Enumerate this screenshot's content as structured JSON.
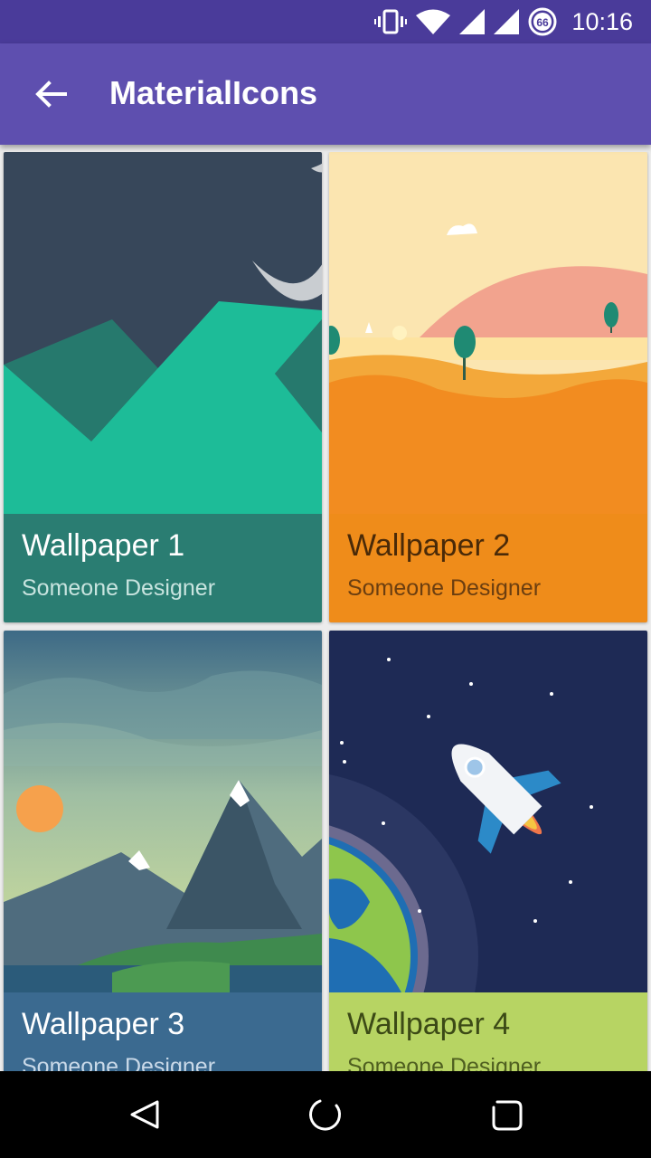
{
  "status_bar": {
    "time": "10:16",
    "battery_level": "66",
    "icons": [
      "vibrate-icon",
      "wifi-icon",
      "signal-icon",
      "signal-icon",
      "battery-icon"
    ]
  },
  "app_bar": {
    "title": "MaterialIcons",
    "back_icon": "back-arrow-icon"
  },
  "cards": [
    {
      "title": "Wallpaper 1",
      "subtitle": "Someone Designer",
      "caption_color": "#2a7d72",
      "text_color": "#ffffff",
      "sub_color": "#c8e4df"
    },
    {
      "title": "Wallpaper 2",
      "subtitle": "Someone Designer",
      "caption_color": "#ef8c1a",
      "text_color": "#4a2a08",
      "sub_color": "#6b3e10"
    },
    {
      "title": "Wallpaper 3",
      "subtitle": "Someone Designer",
      "caption_color": "#3b6a90",
      "text_color": "#ffffff",
      "sub_color": "#c9d9e8"
    },
    {
      "title": "Wallpaper 4",
      "subtitle": "Someone Designer",
      "caption_color": "#b7d463",
      "text_color": "#3c4a16",
      "sub_color": "#4f5f20"
    }
  ],
  "nav_bar": {
    "back": "nav-back-icon",
    "home": "nav-home-icon",
    "recents": "nav-recents-icon"
  }
}
